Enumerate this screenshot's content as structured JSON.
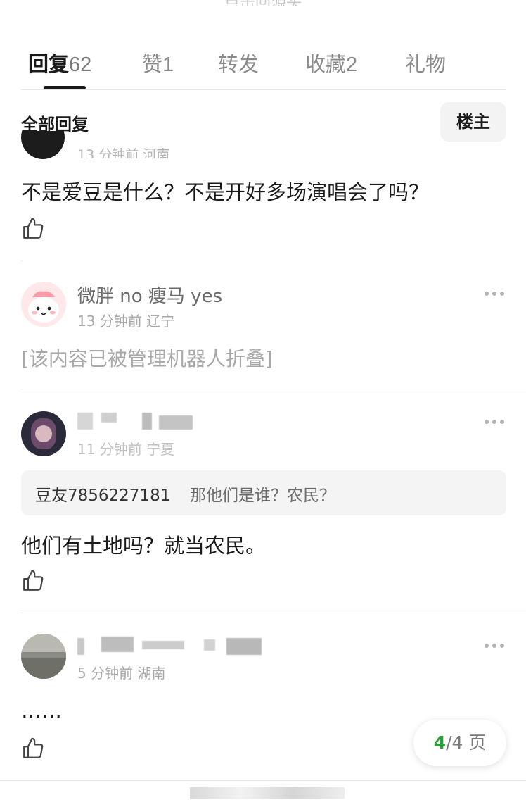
{
  "header": {
    "faded_top": "点击回源头"
  },
  "tabs": [
    {
      "label": "回复",
      "count": "62"
    },
    {
      "label": "赞",
      "count": "1"
    },
    {
      "label": "转发",
      "count": ""
    },
    {
      "label": "收藏",
      "count": "2"
    },
    {
      "label": "礼物",
      "count": ""
    }
  ],
  "filter": {
    "title": "全部回复",
    "owner_button": "楼主"
  },
  "comments": [
    {
      "meta": "13 分钟前 河南",
      "text": "不是爱豆是什么？不是开好多场演唱会了吗？"
    },
    {
      "username": "微胖 no 瘦马 yes",
      "meta": "13 分钟前 辽宁",
      "folded_text": "[该内容已被管理机器人折叠]"
    },
    {
      "meta": "11 分钟前 宁夏",
      "quote_user": "豆友7856227181",
      "quote_text": "那他们是谁？农民？",
      "text": "他们有土地吗？就当农民。"
    },
    {
      "meta": "5 分钟前 湖南",
      "text": "……"
    }
  ],
  "pager": {
    "current": "4",
    "total": "/4 页"
  },
  "icons": {
    "like": "thumbs-up-icon",
    "more": "more-dots-icon"
  },
  "colors": {
    "accent_green": "#2aa33a"
  }
}
